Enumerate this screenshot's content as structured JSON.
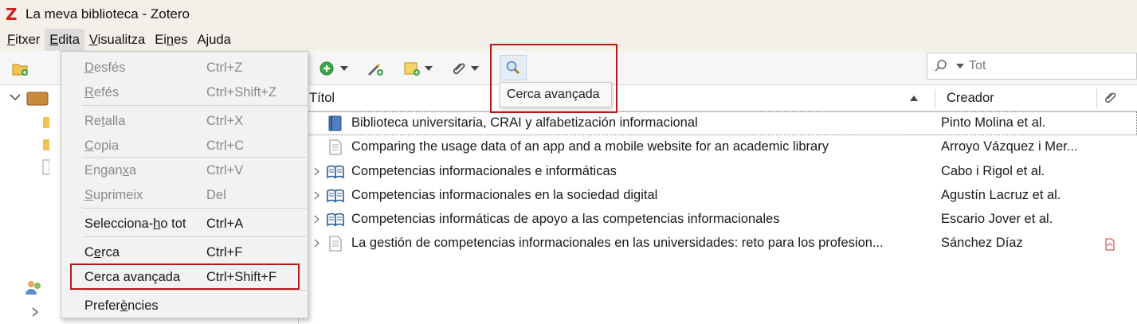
{
  "window": {
    "title": "La meva biblioteca - Zotero",
    "logo": "Z"
  },
  "menubar": [
    {
      "pre": "",
      "u": "F",
      "post": "itxer"
    },
    {
      "pre": "",
      "u": "E",
      "post": "dita"
    },
    {
      "pre": "",
      "u": "V",
      "post": "isualitza"
    },
    {
      "pre": "Ei",
      "u": "n",
      "post": "es"
    },
    {
      "pre": "A",
      "u": "j",
      "post": "uda"
    }
  ],
  "toolbar": {
    "tooltip": "Cerca avançada",
    "search_placeholder": "Tot"
  },
  "edit_menu": [
    {
      "pre": "",
      "u": "D",
      "post": "esfés",
      "shortcut": "Ctrl+Z",
      "disabled": true
    },
    {
      "pre": "",
      "u": "R",
      "post": "efés",
      "shortcut": "Ctrl+Shift+Z",
      "disabled": true
    },
    {
      "pre": "Re",
      "u": "t",
      "post": "alla",
      "shortcut": "Ctrl+X",
      "disabled": true
    },
    {
      "pre": "",
      "u": "C",
      "post": "opia",
      "shortcut": "Ctrl+C",
      "disabled": true
    },
    {
      "pre": "Engan",
      "u": "x",
      "post": "a",
      "shortcut": "Ctrl+V",
      "disabled": true
    },
    {
      "pre": "",
      "u": "S",
      "post": "uprimeix",
      "shortcut": "Del",
      "disabled": true
    },
    {
      "pre": "Selecciona-",
      "u": "h",
      "post": "o tot",
      "shortcut": "Ctrl+A",
      "disabled": false
    },
    {
      "pre": "C",
      "u": "e",
      "post": "rca",
      "shortcut": "Ctrl+F",
      "disabled": false
    },
    {
      "pre": "Cerca avançada",
      "u": "",
      "post": "",
      "shortcut": "Ctrl+Shift+F",
      "disabled": false
    },
    {
      "pre": "Prefer",
      "u": "è",
      "post": "ncies",
      "shortcut": "",
      "disabled": false
    }
  ],
  "list": {
    "col_title": "Títol",
    "col_creator": "Creador",
    "rows": [
      {
        "title": "Biblioteca universitaria, CRAI y alfabetización informacional",
        "creator": "Pinto Molina et al.",
        "icon": "book-icon",
        "twisty": false,
        "pdf": false
      },
      {
        "title": "Comparing the usage data of an app and a mobile website for an academic library",
        "creator": "Arroyo Vázquez i Mer...",
        "icon": "document-icon",
        "twisty": false,
        "pdf": false
      },
      {
        "title": "Competencias informacionales e informáticas",
        "creator": "Cabo i Rigol et al.",
        "icon": "open-book-icon",
        "twisty": true,
        "pdf": false
      },
      {
        "title": "Competencias informacionales en la sociedad digital",
        "creator": "Agustín Lacruz et al.",
        "icon": "open-book-icon",
        "twisty": true,
        "pdf": false
      },
      {
        "title": "Competencias informáticas de apoyo a las competencias informacionales",
        "creator": "Escario Jover et al.",
        "icon": "open-book-icon",
        "twisty": true,
        "pdf": false
      },
      {
        "title": "La gestión de competencias informacionales en las universidades: reto para los profesion...",
        "creator": "Sánchez Díaz",
        "icon": "document-icon",
        "twisty": true,
        "pdf": true
      }
    ]
  },
  "colors": {
    "highlight": "#b31b1b",
    "titlebar": "#f4efe9",
    "menu_bg": "#f2f2f2"
  }
}
